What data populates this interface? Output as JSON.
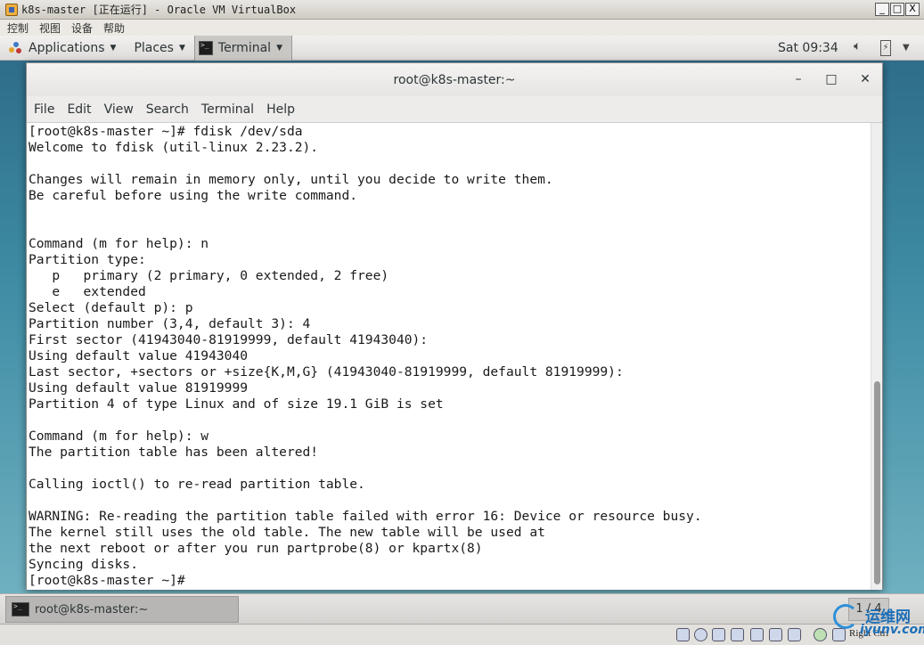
{
  "vbox": {
    "title": "k8s-master [正在运行] - Oracle VM VirtualBox",
    "menu": [
      "控制",
      "视图",
      "设备",
      "帮助"
    ],
    "win_controls": [
      "_",
      "□",
      "X"
    ]
  },
  "gnome_panel": {
    "applications": "Applications",
    "places": "Places",
    "terminal": "Terminal",
    "clock": "Sat 09:34"
  },
  "terminal_window": {
    "title": "root@k8s-master:~",
    "controls": [
      "–",
      "□",
      "✕"
    ],
    "menu": [
      "File",
      "Edit",
      "View",
      "Search",
      "Terminal",
      "Help"
    ],
    "lines": [
      "[root@k8s-master ~]# fdisk /dev/sda",
      "Welcome to fdisk (util-linux 2.23.2).",
      "",
      "Changes will remain in memory only, until you decide to write them.",
      "Be careful before using the write command.",
      "",
      "",
      "Command (m for help): n",
      "Partition type:",
      "   p   primary (2 primary, 0 extended, 2 free)",
      "   e   extended",
      "Select (default p): p",
      "Partition number (3,4, default 3): 4",
      "First sector (41943040-81919999, default 41943040):",
      "Using default value 41943040",
      "Last sector, +sectors or +size{K,M,G} (41943040-81919999, default 81919999):",
      "Using default value 81919999",
      "Partition 4 of type Linux and of size 19.1 GiB is set",
      "",
      "Command (m for help): w",
      "The partition table has been altered!",
      "",
      "Calling ioctl() to re-read partition table.",
      "",
      "WARNING: Re-reading the partition table failed with error 16: Device or resource busy.",
      "The kernel still uses the old table. The new table will be used at",
      "the next reboot or after you run partprobe(8) or kpartx(8)",
      "Syncing disks.",
      "[root@k8s-master ~]# "
    ]
  },
  "taskbar": {
    "task_label": "root@k8s-master:~",
    "pager": "1 / 4"
  },
  "statusbar": {
    "hostkey": "Right Ctrl"
  },
  "watermark": {
    "line1": "运维网",
    "line2": "iyunv.com"
  }
}
